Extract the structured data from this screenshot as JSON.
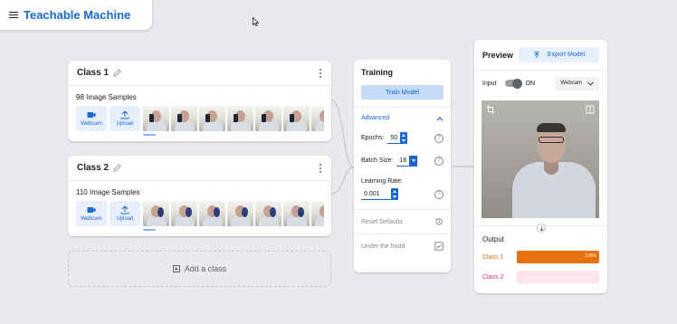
{
  "header": {
    "title": "Teachable Machine"
  },
  "classes": [
    {
      "name": "Class 1",
      "samples_label": "98 Image Samples"
    },
    {
      "name": "Class 2",
      "samples_label": "110 Image Samples"
    }
  ],
  "sample_tools": {
    "webcam_label": "Webcam",
    "upload_label": "Upload"
  },
  "add_class_label": "Add a class",
  "training": {
    "title": "Training",
    "train_button": "Train Model",
    "advanced_label": "Advanced",
    "epochs_label": "Epochs:",
    "epochs_value": "50",
    "batch_size_label": "Batch Size:",
    "batch_size_value": "16",
    "learning_rate_label": "Learning Rate:",
    "learning_rate_value": "0.001",
    "reset_defaults_label": "Reset Defaults",
    "under_the_hood_label": "Under the hood"
  },
  "preview": {
    "title": "Preview",
    "export_button": "Export Model",
    "input_label": "Input",
    "toggle_state": "ON",
    "source_select": "Webcam",
    "output_label": "Output",
    "outputs": [
      {
        "name": "Class 1",
        "percent_label": "100%",
        "fraction": 1.0,
        "color": "#e8710a",
        "track": "#fce8d8"
      },
      {
        "name": "Class 2",
        "percent_label": "",
        "fraction": 0.0,
        "color": "#e52592",
        "track": "#fde5ee"
      }
    ]
  },
  "colors": {
    "accent": "#1967d2",
    "class1": "#e8710a",
    "class2": "#e52592"
  }
}
